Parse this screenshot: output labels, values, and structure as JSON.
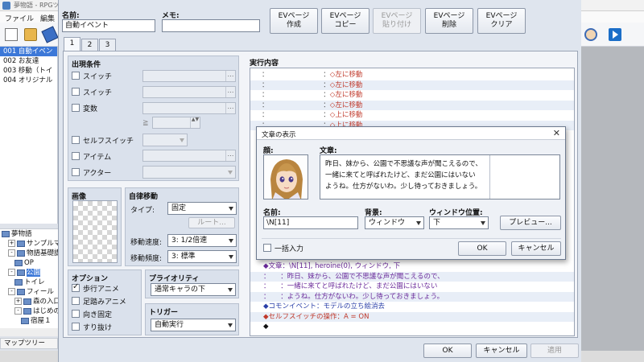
{
  "app": {
    "title": "夢物語 - RPGツク"
  },
  "menu": {
    "file": "ファイル",
    "edit": "編集"
  },
  "map_events": [
    {
      "label": "001 自動イベン",
      "selected": true
    },
    {
      "label": "002 お友達",
      "selected": false
    },
    {
      "label": "003 移動（トイ",
      "selected": false
    },
    {
      "label": "004 オリジナル",
      "selected": false
    }
  ],
  "map_tree": [
    {
      "toggle": "",
      "label": "夢物語",
      "indent": 0,
      "selected": false
    },
    {
      "toggle": "+",
      "label": "サンプルマ",
      "indent": 1,
      "selected": false
    },
    {
      "toggle": "-",
      "label": "物語基礎講",
      "indent": 1,
      "selected": false
    },
    {
      "toggle": "",
      "label": "OP",
      "indent": 2,
      "selected": false
    },
    {
      "toggle": "-",
      "label": "公園",
      "indent": 1,
      "selected": true
    },
    {
      "toggle": "",
      "label": "トイレ",
      "indent": 2,
      "selected": false
    },
    {
      "toggle": "-",
      "label": "フィール",
      "indent": 1,
      "selected": false
    },
    {
      "toggle": "+",
      "label": "森の入口",
      "indent": 2,
      "selected": false
    },
    {
      "toggle": "-",
      "label": "はじめの",
      "indent": 2,
      "selected": false
    },
    {
      "toggle": "",
      "label": "宿屋１",
      "indent": 3,
      "selected": false
    }
  ],
  "map_tree_tab": "マップツリー",
  "event": {
    "name_label": "名前:",
    "name_value": "自動イベント",
    "memo_label": "メモ:",
    "memo_value": ""
  },
  "page_buttons": [
    {
      "label": "EVページ\n作成",
      "disabled": false
    },
    {
      "label": "EVページ\nコピー",
      "disabled": false
    },
    {
      "label": "EVページ\n貼り付け",
      "disabled": true
    },
    {
      "label": "EVページ\n削除",
      "disabled": false
    },
    {
      "label": "EVページ\nクリア",
      "disabled": false
    }
  ],
  "tabs": [
    "1",
    "2",
    "3"
  ],
  "conditions": {
    "title": "出現条件",
    "switch1": "スイッチ",
    "switch2": "スイッチ",
    "variable": "変数",
    "gte": "≧",
    "self_switch": "セルフスイッチ",
    "item": "アイテム",
    "actor": "アクター"
  },
  "image": {
    "title": "画像"
  },
  "autonomous": {
    "title": "自律移動",
    "type_label": "タイプ:",
    "type_value": "固定",
    "route_button": "ルート...",
    "speed_label": "移動速度:",
    "speed_value": "3: 1/2倍速",
    "freq_label": "移動頻度:",
    "freq_value": "3: 標準"
  },
  "options": {
    "title": "オプション",
    "walk_anim": {
      "label": "歩行アニメ",
      "checked": true
    },
    "step_anim": {
      "label": "足踏みアニメ",
      "checked": false
    },
    "dir_fix": {
      "label": "向き固定",
      "checked": false
    },
    "through": {
      "label": "すり抜け",
      "checked": false
    }
  },
  "priority": {
    "title": "プライオリティ",
    "value": "通常キャラの下"
  },
  "trigger": {
    "title": "トリガー",
    "value": "自動実行"
  },
  "contents": {
    "title": "実行内容",
    "rows_top": [
      {
        "prefix": "：",
        "mid": "：",
        "text": "◇左に移動"
      },
      {
        "prefix": "：",
        "mid": "：",
        "text": "◇左に移動"
      },
      {
        "prefix": "：",
        "mid": "：",
        "text": "◇左に移動"
      },
      {
        "prefix": "：",
        "mid": "：",
        "text": "◇左に移動"
      },
      {
        "prefix": "：",
        "mid": "：",
        "text": "◇上に移動"
      },
      {
        "prefix": "：",
        "mid": "：",
        "text": "◇上に移動"
      }
    ],
    "rows_bottom": [
      {
        "kind": "purple",
        "text": "◆文章：\\N[11], heroine(0), ウィンドウ, 下"
      },
      {
        "kind": "purple-cont",
        "text": "：　　：昨日、妹から、公園で不思議な声が聞こえるので、"
      },
      {
        "kind": "purple-cont",
        "text": "：　　：一緒に来てと呼ばれたけど、まだ公園にはいない"
      },
      {
        "kind": "purple-cont",
        "text": "：　　：ようね。仕方がないわ。少し待っておきましょう。"
      },
      {
        "kind": "blue",
        "text": "◆コモンイベント：モデルの立ち絵消去"
      },
      {
        "kind": "red",
        "text": "◆セルフスイッチの操作：A = ON"
      },
      {
        "kind": "plain",
        "text": "◆"
      }
    ]
  },
  "dialog": {
    "title": "文章の表示",
    "close": "✕",
    "face_label": "顔:",
    "text_label": "文章:",
    "text_lines": [
      "昨日、妹から、公園で不思議な声が聞こえるので、",
      "一緒に来てと呼ばれたけど、まだ公園にはいない",
      "ようね。仕方がないわ。少し待っておきましょう。"
    ],
    "name_label": "名前:",
    "name_value": "\\N[11]",
    "bg_label": "背景:",
    "bg_value": "ウィンドウ",
    "pos_label": "ウィンドウ位置:",
    "pos_value": "下",
    "preview": "プレビュー...",
    "batch": {
      "label": "一括入力",
      "checked": false
    },
    "ok": "OK",
    "cancel": "キャンセル"
  },
  "footer": {
    "ok": "OK",
    "cancel": "キャンセル",
    "apply": "適用"
  }
}
